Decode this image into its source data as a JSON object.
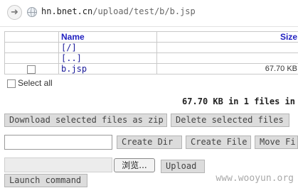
{
  "browser": {
    "url_host": "hn.bnet.cn",
    "url_path": "/upload/test/b/b.jsp",
    "back_icon": "arrow-icon",
    "site_icon": "globe-icon"
  },
  "table": {
    "headers": {
      "name": "Name",
      "size": "Size"
    },
    "rows": [
      {
        "name": "[/]",
        "size": ""
      },
      {
        "name": "[..]",
        "size": ""
      },
      {
        "name": "b.jsp",
        "size": "67.70 KB"
      }
    ]
  },
  "select_all_label": "Select all",
  "summary": "67.70 KB in 1 files in",
  "buttons": {
    "download_zip": "Download selected files as zip",
    "delete_selected": "Delete selected files",
    "create_dir": "Create Dir",
    "create_file": "Create File",
    "move_file": "Move Fi",
    "browse": "浏览...",
    "upload": "Upload",
    "launch_command": "Launch command"
  },
  "watermark": "www.wooyun.org"
}
